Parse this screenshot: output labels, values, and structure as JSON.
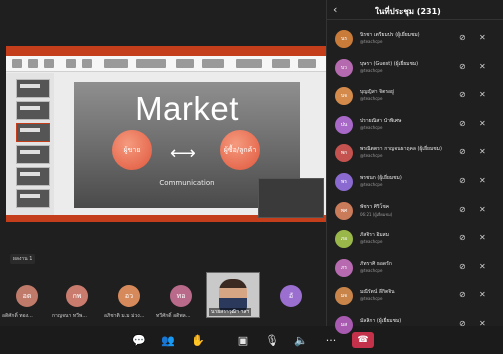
{
  "slide": {
    "title": "Market",
    "left_circle": "ผู้ขาย",
    "right_circle": "ผู้ซื้อ/ลูกค้า",
    "arrow": "⟷",
    "caption": "Communication"
  },
  "sharer_label": "ผลงาน 1",
  "gallery": [
    {
      "initials": "อด",
      "name": "อดิศักดิ์ ทอง...",
      "color": "#c07a6a"
    },
    {
      "initials": "กพ",
      "name": "กาญจนา ทวีพ...",
      "color": "#c97b6e"
    },
    {
      "initials": "อว",
      "name": "อภิชาติ ม.ม ม่วง...",
      "color": "#d68a5c"
    },
    {
      "initials": "ทอ",
      "name": "ทวีศักดิ์ อดิพล...",
      "color": "#b96a8a"
    }
  ],
  "video_tile_name": "นายสราวุฒิฯ ฯลฯ",
  "last_tile": {
    "initials": "อั",
    "color": "#9b6fd0"
  },
  "panel": {
    "title": "ในที่ประชุม (231)",
    "back_icon": "‹",
    "participants": [
      {
        "initials": "นร",
        "name": "นิรชา เตรียมปร (ผู้เยี่ยมชม)",
        "sub": "@teachcpe",
        "color": "#c97b3a"
      },
      {
        "initials": "บว",
        "name": "บุษรา (Guest) (ผู้เยี่ยมชม)",
        "sub": "@teachcpe",
        "color": "#b56ab0"
      },
      {
        "initials": "บจ",
        "name": "บุญญิสา จิตรอยู่",
        "sub": "@teachcpe",
        "color": "#d38a4a"
      },
      {
        "initials": "ปน",
        "name": "ปรายณิสา นำพิเศษ",
        "sub": "@teachcpe",
        "color": "#a868c8"
      },
      {
        "initials": "พก",
        "name": "พรณิตตรา กาญจนธาฤคล (ผู้เยี่ยมชม)",
        "sub": "@teachcpe",
        "color": "#c4524e"
      },
      {
        "initials": "พร",
        "name": "พรชนก (ผู้เยี่ยมชม)",
        "sub": "@teachcpe",
        "color": "#8a6ad0"
      },
      {
        "initials": "พศ",
        "name": "พัชรา ศิริโชค",
        "sub": "06:21 (ผู้เยี่ยมชม)",
        "color": "#c97b5a"
      },
      {
        "initials": "ภอ",
        "name": "ภัสจิรา อิมสม",
        "sub": "@teachcpe",
        "color": "#9ab84a"
      },
      {
        "initials": "ภร",
        "name": "ภัทราศิ ธอดรัก",
        "sub": "@teachcpe",
        "color": "#b86ab0"
      },
      {
        "initials": "มจ",
        "name": "มณีรัตน์ ลีกิตจิน",
        "sub": "@teachcpe",
        "color": "#c9844a"
      },
      {
        "initials": "มส",
        "name": "มัลลิกา (ผู้เยี่ยมชม)",
        "sub": "",
        "color": "#a85ab0"
      }
    ]
  },
  "icons": {
    "camera_off": "⊘",
    "mic_off": "✕"
  },
  "callbar": {
    "chat": "💬",
    "people": "👥",
    "raise_hand": "✋",
    "video": "▣",
    "mic": "🎙",
    "speaker": "🔈",
    "more": "···",
    "leave": "☎"
  }
}
